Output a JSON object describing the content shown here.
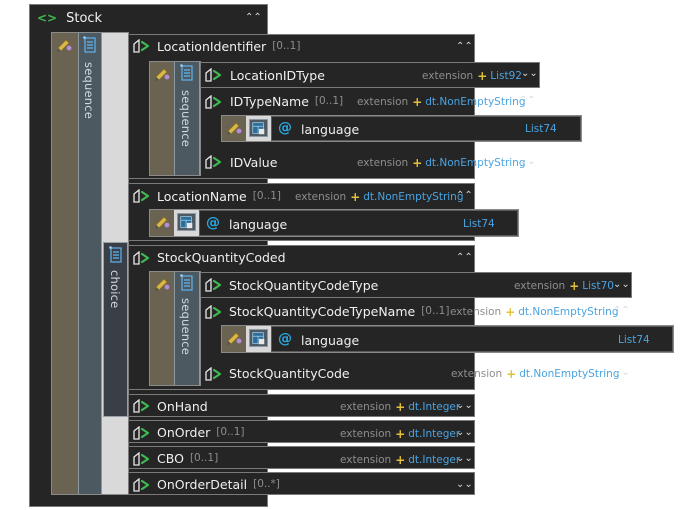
{
  "root": {
    "name": "Stock",
    "icon": "element-icon"
  },
  "labels": {
    "sequence": "sequence",
    "choice": "choice"
  },
  "rows": {
    "location_identifier": {
      "name": "LocationIdentifier",
      "card": "[0..1]"
    },
    "location_id_type": {
      "name": "LocationIDType",
      "ext": "extension",
      "type": "List92"
    },
    "id_type_name": {
      "name": "IDTypeName",
      "card": "[0..1]",
      "ext": "extension",
      "type": "dt.NonEmptyString"
    },
    "id_type_name_lang": {
      "at": "@",
      "name": "language",
      "type": "List74"
    },
    "id_value": {
      "name": "IDValue",
      "ext": "extension",
      "type": "dt.NonEmptyString"
    },
    "location_name": {
      "name": "LocationName",
      "card": "[0..1]",
      "ext": "extension",
      "type": "dt.NonEmptyString"
    },
    "location_name_lang": {
      "at": "@",
      "name": "language",
      "type": "List74"
    },
    "stock_quantity_coded": {
      "name": "StockQuantityCoded"
    },
    "sq_code_type": {
      "name": "StockQuantityCodeType",
      "ext": "extension",
      "type": "List70"
    },
    "sq_code_type_name": {
      "name": "StockQuantityCodeTypeName",
      "card": "[0..1]",
      "ext": "extension",
      "type": "dt.NonEmptyString"
    },
    "sq_code_type_name_lang": {
      "at": "@",
      "name": "language",
      "type": "List74"
    },
    "sq_code": {
      "name": "StockQuantityCode",
      "ext": "extension",
      "type": "dt.NonEmptyString"
    },
    "on_hand": {
      "name": "OnHand",
      "ext": "extension",
      "type": "dt.Integer"
    },
    "on_order": {
      "name": "OnOrder",
      "card": "[0..1]",
      "ext": "extension",
      "type": "dt.Integer"
    },
    "cbo": {
      "name": "CBO",
      "card": "[0..1]",
      "ext": "extension",
      "type": "dt.Integer"
    },
    "on_order_detail": {
      "name": "OnOrderDetail",
      "card": "[0..*]"
    }
  },
  "colors": {
    "panel": "#252526",
    "accent_blue": "#4aa3e0",
    "plus_yellow": "#e2c23a",
    "tag_green": "#3fb950"
  }
}
